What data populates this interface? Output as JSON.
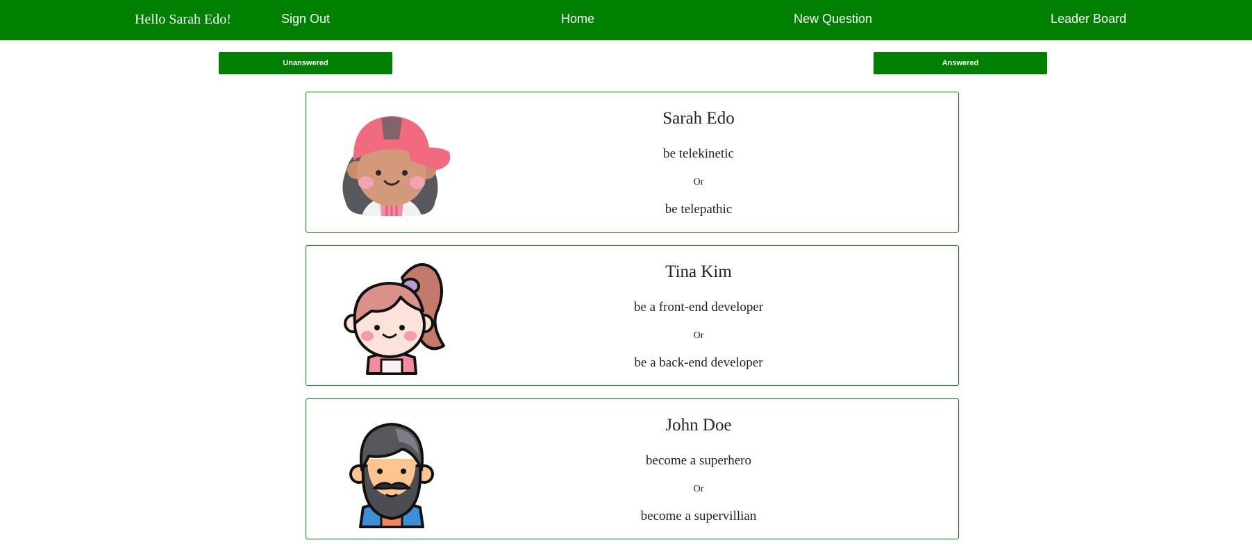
{
  "nav": {
    "greeting": "Hello Sarah Edo!",
    "sign_out": "Sign Out",
    "home": "Home",
    "new_question": "New Question",
    "leader_board": "Leader Board"
  },
  "tabs": {
    "unanswered": "Unanswered",
    "answered": "Answered"
  },
  "questions": [
    {
      "author": "Sarah Edo",
      "avatar": "girl-with-pink-cap-avatar",
      "option_one": "be telekinetic",
      "or": "Or",
      "option_two": "be telepathic"
    },
    {
      "author": "Tina Kim",
      "avatar": "girl-with-ponytail-avatar",
      "option_one": "be a front-end developer",
      "or": "Or",
      "option_two": "be a back-end developer"
    },
    {
      "author": "John Doe",
      "avatar": "bearded-man-avatar",
      "option_one": "become a superhero",
      "or": "Or",
      "option_two": "become a supervillian"
    }
  ],
  "colors": {
    "primary": "#008000",
    "on_primary": "#ffffff"
  }
}
